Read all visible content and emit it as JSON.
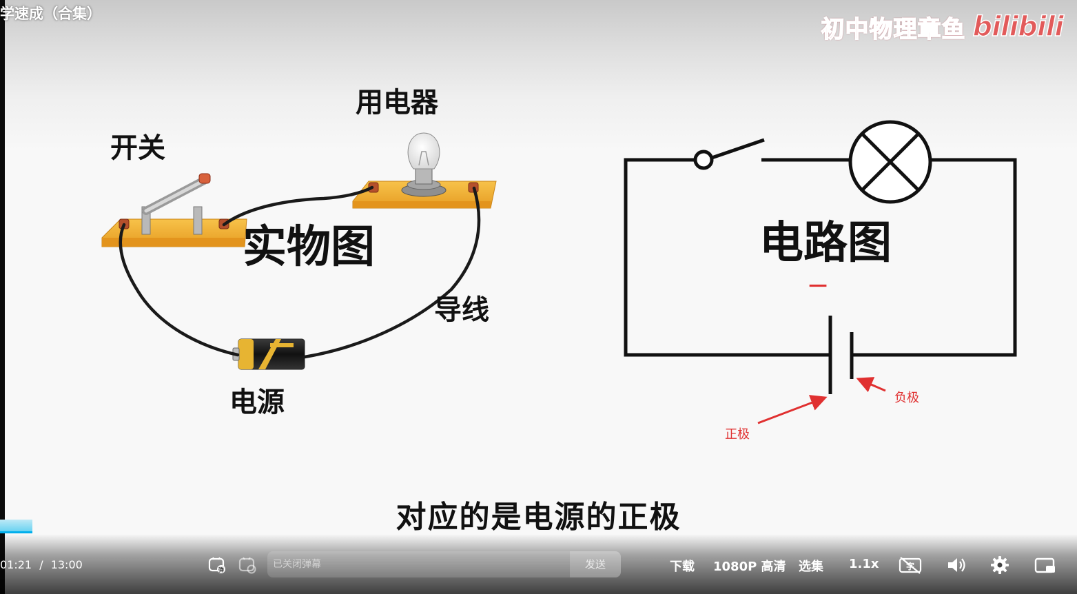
{
  "video": {
    "title": "学速成（合集）",
    "watermark_text": "初中物理章鱼",
    "watermark_logo": "bilibili"
  },
  "slide": {
    "left_labels": {
      "appliance": "用电器",
      "switch": "开关",
      "real_diagram": "实物图",
      "wire": "导线",
      "power": "电源"
    },
    "right_labels": {
      "circuit_diagram": "电路图",
      "positive": "正极",
      "negative": "负极",
      "red_mark": "一"
    },
    "accent_red": "#e03030"
  },
  "subtitle": "对应的是电源的正极",
  "player": {
    "progress": 0.104,
    "current_time": "01:21",
    "separator": "/",
    "duration": "13:00",
    "danmaku_placeholder": "已关闭弹幕",
    "send_label": "发送",
    "download_label": "下载",
    "quality_label": "1080P 高清",
    "episodes_label": "选集",
    "speed_label": "1.1x",
    "accent": "#00aeec",
    "icons": [
      "danmaku-toggle-icon",
      "danmaku-settings-icon",
      "subtitle-off-icon",
      "volume-icon",
      "settings-gear-icon",
      "picture-in-picture-icon"
    ]
  }
}
